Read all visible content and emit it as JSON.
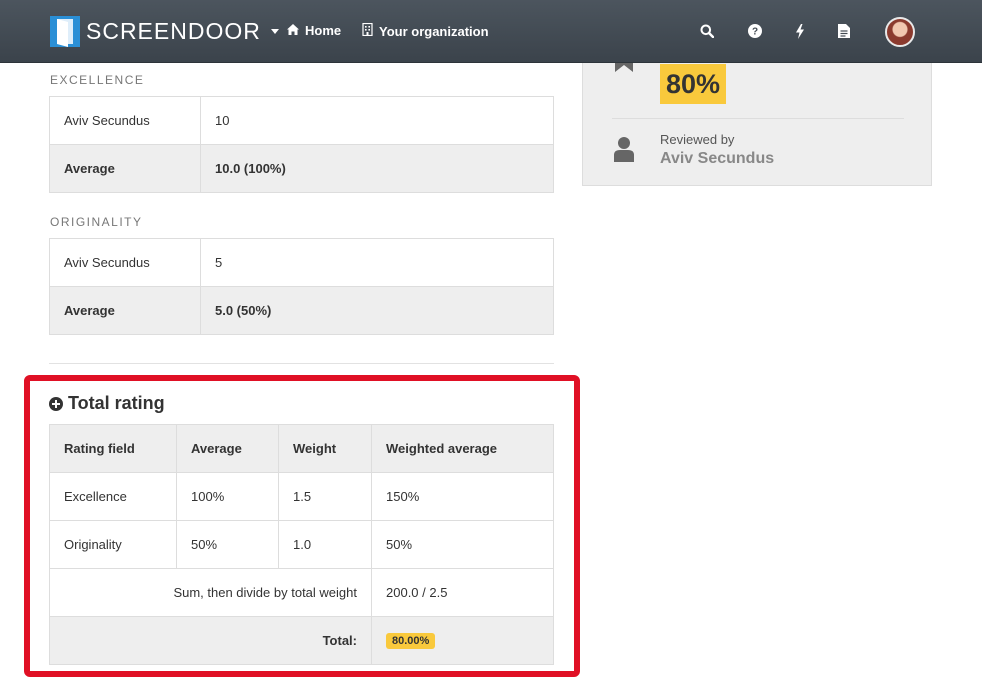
{
  "navbar": {
    "brand": "SCREENDOOR",
    "home_label": "Home",
    "org_label": "Your organization",
    "icons": [
      "search-icon",
      "help-icon",
      "bolt-icon",
      "document-icon"
    ]
  },
  "sections": [
    {
      "label": "EXCELLENCE",
      "rows": [
        {
          "name": "Aviv Secundus",
          "value": "10"
        }
      ],
      "avg_label": "Average",
      "avg_value": "10.0 (100%)"
    },
    {
      "label": "ORIGINALITY",
      "rows": [
        {
          "name": "Aviv Secundus",
          "value": "5"
        }
      ],
      "avg_label": "Average",
      "avg_value": "5.0 (50%)"
    }
  ],
  "total": {
    "title": "Total rating",
    "headers": [
      "Rating field",
      "Average",
      "Weight",
      "Weighted average"
    ],
    "rows": [
      [
        "Excellence",
        "100%",
        "1.5",
        "150%"
      ],
      [
        "Originality",
        "50%",
        "1.0",
        "50%"
      ]
    ],
    "sum_label": "Sum, then divide by total weight",
    "sum_value": "200.0 / 2.5",
    "total_label": "Total:",
    "total_value": "80.00%"
  },
  "side": {
    "score": "80%",
    "reviewed_label": "Reviewed by",
    "reviewer": "Aviv Secundus"
  },
  "colors": {
    "navbar": "#434b53",
    "highlight": "#e01025",
    "badge": "#f9c93c"
  }
}
